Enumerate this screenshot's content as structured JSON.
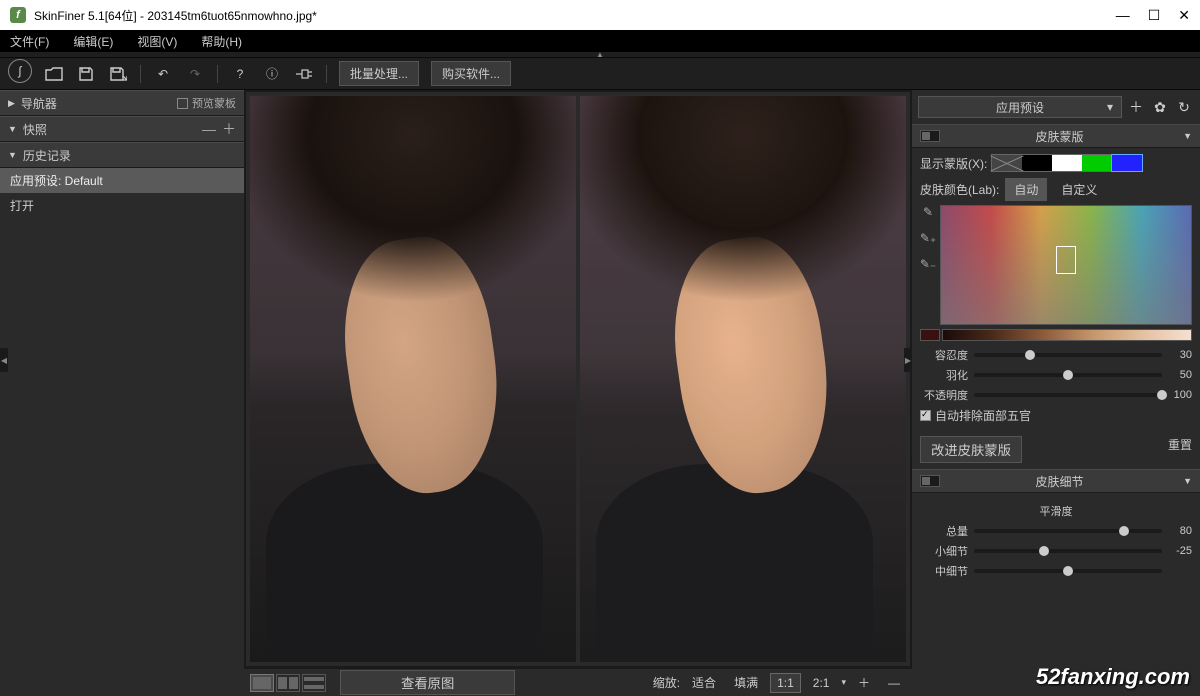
{
  "title": "SkinFiner 5.1[64位] - 203145tm6tuot65nmowhno.jpg*",
  "menu": {
    "file": "文件(F)",
    "edit": "编辑(E)",
    "view": "视图(V)",
    "help": "帮助(H)"
  },
  "toolbar": {
    "batch": "批量处理...",
    "buy": "购买软件..."
  },
  "left": {
    "navigator": "导航器",
    "preview_mask": "预览蒙板",
    "snapshot": "快照",
    "history": "历史记录",
    "hist_items": [
      "应用预设: Default",
      "打开"
    ]
  },
  "bottom": {
    "view_original": "查看原图",
    "zoom": "缩放:",
    "fit": "适合",
    "fill": "填满",
    "r11": "1:1",
    "r21": "2:1"
  },
  "right": {
    "apply_preset": "应用预设",
    "skin_mask": "皮肤蒙版",
    "show_mask": "显示蒙版(X):",
    "skin_color_lab": "皮肤颜色(Lab):",
    "auto": "自动",
    "custom": "自定义",
    "tolerance": "容忍度",
    "tolerance_v": "30",
    "feather": "羽化",
    "feather_v": "50",
    "opacity": "不透明度",
    "opacity_v": "100",
    "exclude": "自动排除面部五官",
    "improve_mask": "改进皮肤蒙版",
    "reset": "重置",
    "skin_detail": "皮肤细节",
    "smoothness": "平滑度",
    "amount": "总量",
    "amount_v": "80",
    "small": "小细节",
    "small_v": "-25",
    "medium": "中细节"
  },
  "watermark": "52fanxing.com"
}
